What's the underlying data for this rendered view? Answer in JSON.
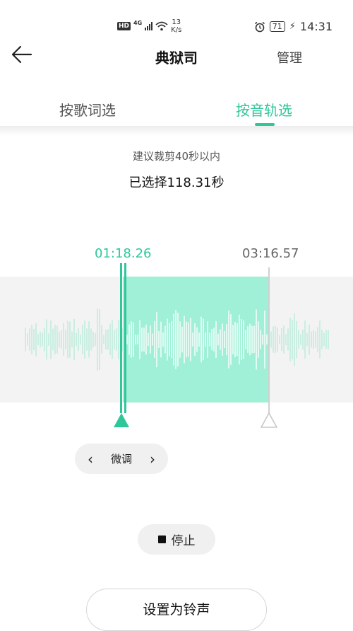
{
  "status_bar": {
    "network_badge": "HD",
    "signal_type": "4G",
    "speed_value": "13",
    "speed_unit": "K/s",
    "battery": "71",
    "time": "14:31"
  },
  "header": {
    "title": "典狱司",
    "manage_label": "管理"
  },
  "tabs": [
    {
      "label": "按歌词选",
      "active": false
    },
    {
      "label": "按音轨选",
      "active": true
    }
  ],
  "hint": "建议裁剪40秒以内",
  "selected_text": "已选择118.31秒",
  "selection": {
    "start_time": "01:18.26",
    "end_time": "03:16.57"
  },
  "fine_tune_label": "微调",
  "stop_label": "停止",
  "set_ringtone_label": "设置为铃声",
  "colors": {
    "accent": "#2ec79a",
    "selection_fill": "#9ff0d6",
    "wave_bg": "#f3f3f3"
  }
}
